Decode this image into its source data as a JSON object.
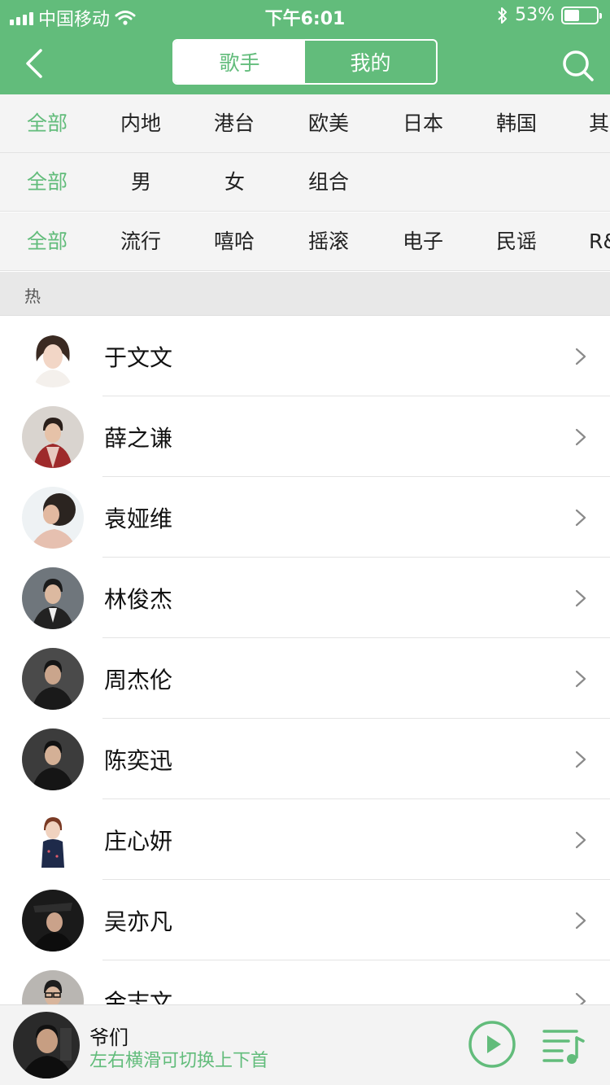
{
  "status": {
    "carrier": "中国移动",
    "time": "下午6:01",
    "battery": "53%",
    "battery_level": 0.53
  },
  "nav": {
    "tabs": [
      {
        "label": "歌手",
        "active": true
      },
      {
        "label": "我的",
        "active": false
      }
    ],
    "accent": "#62bc7b"
  },
  "filters": {
    "region": [
      "全部",
      "内地",
      "港台",
      "欧美",
      "日本",
      "韩国",
      "其"
    ],
    "gender": [
      "全部",
      "男",
      "女",
      "组合"
    ],
    "genre": [
      "全部",
      "流行",
      "嘻哈",
      "摇滚",
      "电子",
      "民谣",
      "R&"
    ]
  },
  "section": {
    "label": "热"
  },
  "artists": [
    {
      "name": "于文文"
    },
    {
      "name": "薛之谦"
    },
    {
      "name": "袁娅维"
    },
    {
      "name": "林俊杰"
    },
    {
      "name": "周杰伦"
    },
    {
      "name": "陈奕迅"
    },
    {
      "name": "庄心妍"
    },
    {
      "name": "吴亦凡"
    },
    {
      "name": "金志文"
    }
  ],
  "player": {
    "song_title": "爷们",
    "hint": "左右横滑可切换上下首"
  }
}
